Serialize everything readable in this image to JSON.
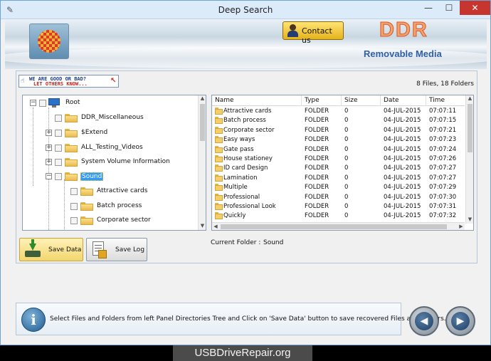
{
  "window": {
    "title": "Deep Search",
    "min_glyph": "—",
    "max_glyph": "☐",
    "close_glyph": "✕"
  },
  "header": {
    "contact_label": "Contact us",
    "brand": "DDR",
    "subbrand": "Removable Media"
  },
  "banner": {
    "line1": "WE ARE GOOD OR BAD?",
    "line2": "LET OTHERS KNOW..."
  },
  "file_count": "8 Files, 18 Folders",
  "tree": {
    "root": "Root",
    "items": [
      {
        "label": "DDR_Miscellaneous",
        "expander": ""
      },
      {
        "label": "$Extend",
        "expander": "+"
      },
      {
        "label": "ALL_Testing_Videos",
        "expander": "+"
      },
      {
        "label": "System Volume Information",
        "expander": "+"
      },
      {
        "label": "Sound",
        "expander": "−"
      },
      {
        "label": "Attractive cards",
        "expander": ""
      },
      {
        "label": "Batch process",
        "expander": ""
      },
      {
        "label": "Corporate sector",
        "expander": ""
      }
    ],
    "root_expander": "−"
  },
  "list": {
    "columns": [
      "Name",
      "Type",
      "Size",
      "Date",
      "Time"
    ],
    "rows": [
      {
        "name": "Attractive cards",
        "type": "FOLDER",
        "size": "0",
        "date": "04-JUL-2015",
        "time": "07:07:11"
      },
      {
        "name": "Batch process",
        "type": "FOLDER",
        "size": "0",
        "date": "04-JUL-2015",
        "time": "07:07:15"
      },
      {
        "name": "Corporate sector",
        "type": "FOLDER",
        "size": "0",
        "date": "04-JUL-2015",
        "time": "07:07:21"
      },
      {
        "name": "Easy ways",
        "type": "FOLDER",
        "size": "0",
        "date": "04-JUL-2015",
        "time": "07:07:23"
      },
      {
        "name": "Gate pass",
        "type": "FOLDER",
        "size": "0",
        "date": "04-JUL-2015",
        "time": "07:07:24"
      },
      {
        "name": "House stationey",
        "type": "FOLDER",
        "size": "0",
        "date": "04-JUL-2015",
        "time": "07:07:26"
      },
      {
        "name": "ID card Design",
        "type": "FOLDER",
        "size": "0",
        "date": "04-JUL-2015",
        "time": "07:07:27"
      },
      {
        "name": "Lamination",
        "type": "FOLDER",
        "size": "0",
        "date": "04-JUL-2015",
        "time": "07:07:27"
      },
      {
        "name": "Multiple",
        "type": "FOLDER",
        "size": "0",
        "date": "04-JUL-2015",
        "time": "07:07:29"
      },
      {
        "name": "Professional",
        "type": "FOLDER",
        "size": "0",
        "date": "04-JUL-2015",
        "time": "07:07:30"
      },
      {
        "name": "Professional Look",
        "type": "FOLDER",
        "size": "0",
        "date": "04-JUL-2015",
        "time": "07:07:31"
      },
      {
        "name": "Quickly",
        "type": "FOLDER",
        "size": "0",
        "date": "04-JUL-2015",
        "time": "07:07:32"
      }
    ]
  },
  "buttons": {
    "save_data": "Save Data",
    "save_log": "Save Log"
  },
  "current_folder": {
    "label": "Current Folder :",
    "value": "Sound"
  },
  "footer": {
    "info_glyph": "i",
    "message": "Select Files and Folders from left Panel Directories Tree and Click on 'Save Data' button to save recovered Files and Folders.",
    "prev_glyph": "◀",
    "next_glyph": "▶"
  },
  "watermark": "USBDriveRepair.org",
  "colors": {
    "selection": "#3399ff",
    "close_button": "#c7352f",
    "brand": "#f3a36a",
    "subbrand": "#2f5fa6"
  }
}
